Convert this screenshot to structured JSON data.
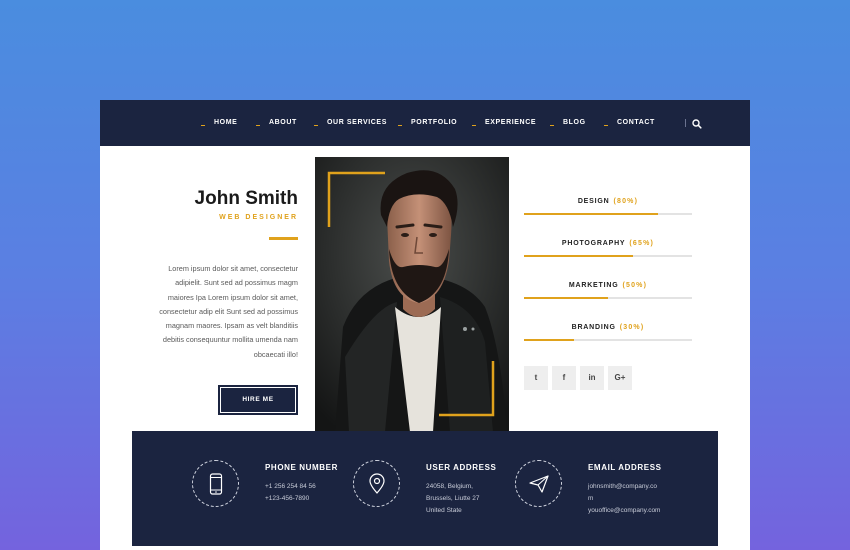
{
  "nav": {
    "items": [
      "HOME",
      "ABOUT",
      "OUR SERVICES",
      "PORTFOLIO",
      "EXPERIENCE",
      "BLOG",
      "CONTACT"
    ],
    "search_icon": "search-icon"
  },
  "profile": {
    "name": "John Smith",
    "role": "WEB DESIGNER",
    "bio": "Lorem ipsum dolor sit amet, consectetur adipielit. Sunt sed ad possimus magm maiores Ipa Lorem ipsum dolor sit amet, consectetur adip elit Sunt sed ad possimus magnam maores. Ipsam as velt blanditiis debitis consequuntur mollita umenda nam obcaecati illo!",
    "hire_label": "HIRE ME"
  },
  "skills": [
    {
      "label": "DESIGN",
      "percent_text": "(80%)",
      "value": 80
    },
    {
      "label": "PHOTOGRAPHY",
      "percent_text": "(65%)",
      "value": 65
    },
    {
      "label": "MARKETING",
      "percent_text": "(50%)",
      "value": 50
    },
    {
      "label": "BRANDING",
      "percent_text": "(30%)",
      "value": 30
    }
  ],
  "social": [
    {
      "icon": "twitter-icon",
      "glyph": "t"
    },
    {
      "icon": "facebook-icon",
      "glyph": "f"
    },
    {
      "icon": "linkedin-icon",
      "glyph": "in"
    },
    {
      "icon": "google-plus-icon",
      "glyph": "G+"
    }
  ],
  "contact": {
    "phone": {
      "title": "PHONE NUMBER",
      "lines": [
        "+1 256 254 84 56",
        "+123-456-7890"
      ],
      "icon": "smartphone-icon"
    },
    "address": {
      "title": "USER ADDRESS",
      "lines": [
        "24058, Belgium,",
        "Brussels, Liutte 27",
        "United State"
      ],
      "icon": "location-pin-icon"
    },
    "email": {
      "title": "EMAIL ADDRESS",
      "lines": [
        "johnsmith@company.co",
        "m",
        "youoffice@company.com"
      ],
      "icon": "paper-plane-icon"
    }
  },
  "colors": {
    "navy": "#1b2440",
    "accent": "#e0a21c",
    "background_top": "#4a8ddf",
    "background_bottom": "#7463de"
  }
}
